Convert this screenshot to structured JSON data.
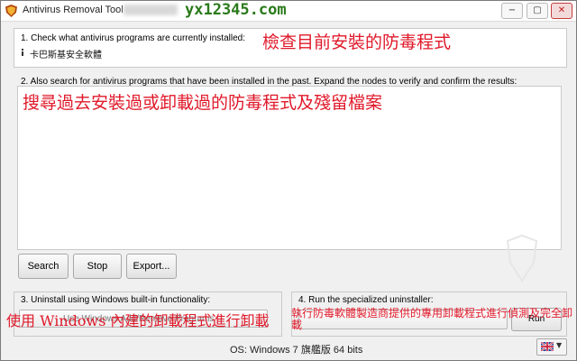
{
  "window": {
    "title": "Antivirus Removal Tool -",
    "watermark": "yx12345.com",
    "minimize_glyph": "−",
    "maximize_glyph": "▢",
    "close_glyph": "✕"
  },
  "section1": {
    "heading": "1. Check what antivirus programs are currently installed:",
    "annotation": "檢查目前安裝的防毒程式",
    "result": "卡巴斯基安全軟體",
    "result_icon": "info-icon"
  },
  "section2": {
    "heading": "2. Also search for antivirus programs that have been installed in the past. Expand the nodes to verify and confirm the results:",
    "annotation": "搜尋過去安裝過或卸載過的防毒程式及殘留檔案",
    "buttons": {
      "search": "Search",
      "stop": "Stop",
      "export": "Export..."
    }
  },
  "section3": {
    "heading": "3. Uninstall using Windows built-in functionality:",
    "combo_value": "Use Windows Add/Remove Programs",
    "annotation": "使用 Windows 內建的卸載程式進行卸載"
  },
  "section4": {
    "heading": "4. Run the specialized uninstaller:",
    "run_label": "Run",
    "annotation": "執行防毒軟體製造商提供的專用卸載程式進行偵測及完全卸載"
  },
  "status": {
    "os": "OS: Windows 7 旗艦版  64 bits"
  },
  "colors": {
    "annotation": "#e0192a",
    "watermark": "#2a7a1a",
    "window_bg": "#f0f0f0"
  }
}
